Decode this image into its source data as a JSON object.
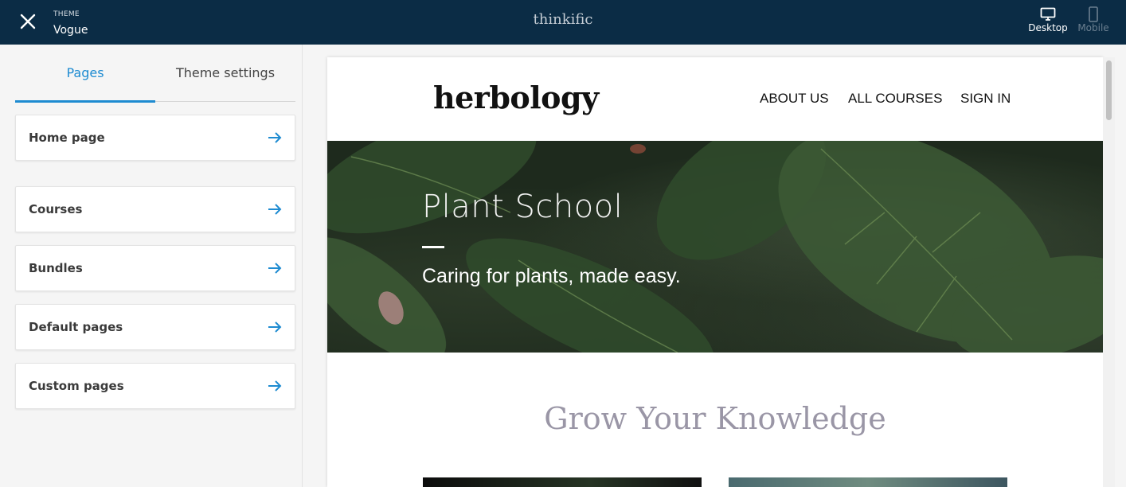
{
  "topbar": {
    "theme_label": "THEME",
    "theme_name": "Vogue",
    "brand": "thinkific",
    "devices": [
      {
        "label": "Desktop",
        "icon": "desktop-icon",
        "active": true
      },
      {
        "label": "Mobile",
        "icon": "mobile-icon",
        "active": false
      }
    ]
  },
  "sidebar": {
    "tabs": [
      {
        "label": "Pages",
        "active": true
      },
      {
        "label": "Theme settings",
        "active": false
      }
    ],
    "items": [
      {
        "label": "Home page"
      },
      {
        "label": "Courses"
      },
      {
        "label": "Bundles"
      },
      {
        "label": "Default pages"
      },
      {
        "label": "Custom pages"
      }
    ]
  },
  "preview": {
    "logo": "herbology",
    "nav": [
      "ABOUT US",
      "ALL COURSES",
      "SIGN IN"
    ],
    "hero_title": "Plant School",
    "hero_subtitle": "Caring for plants, made easy.",
    "section_title": "Grow Your Knowledge"
  },
  "colors": {
    "topbar_bg": "#0b2c45",
    "accent": "#1e8bd1",
    "section_title": "#9a96a6"
  }
}
